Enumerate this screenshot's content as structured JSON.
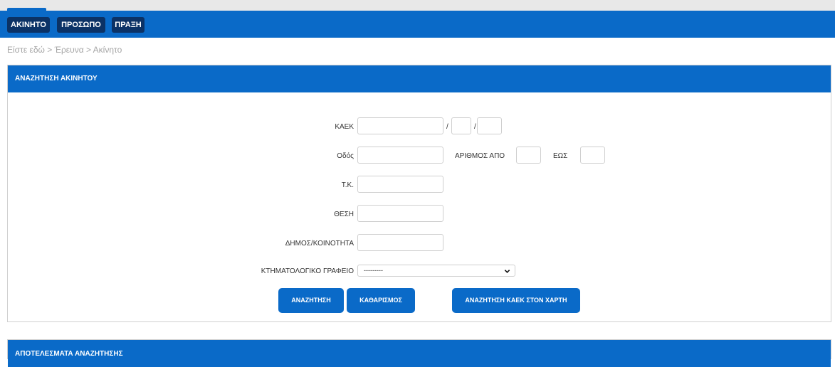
{
  "nav": {
    "items": [
      "ΑΚΙΝΗΤΟ",
      "ΠΡΟΣΩΠΟ",
      "ΠΡΑΞΗ"
    ]
  },
  "breadcrumb": "Είστε εδώ > Έρευνα > Ακίνητο",
  "search_panel": {
    "title": "ΑΝΑΖΗΤΗΣΗ ΑΚΙΝΗΤΟΥ",
    "fields": {
      "kaek_label": "ΚΑΕΚ",
      "kaek_sep": "/",
      "street_label": "Οδός",
      "number_from_label": "ΑΡΙΘΜΟΣ ΑΠΟ",
      "number_to_label": "ΕΩΣ",
      "postal_label": "Τ.Κ.",
      "location_label": "ΘΕΣΗ",
      "municipality_label": "ΔΗΜΟΣ/ΚΟΙΝΟΤΗΤΑ",
      "office_label": "ΚΤΗΜΑΤΟΛΟΓΙΚΟ ΓΡΑΦΕΙΟ",
      "office_selected": "---------"
    },
    "buttons": {
      "search": "ΑΝΑΖΗΤΗΣΗ",
      "clear": "ΚΑΘΑΡΙΣΜΟΣ",
      "map_search": "ΑΝΑΖΗΤΗΣΗ ΚΑΕΚ ΣΤΟΝ ΧΑΡΤΗ"
    }
  },
  "results_panel": {
    "title": "ΑΠΟΤΕΛΕΣΜΑΤΑ ΑΝΑΖΗΤΗΣΗΣ"
  },
  "colors": {
    "primary": "#0a6ac8",
    "nav_button": "#0b3266",
    "border": "#cfcfcf",
    "breadcrumb": "#a5a5a5"
  }
}
